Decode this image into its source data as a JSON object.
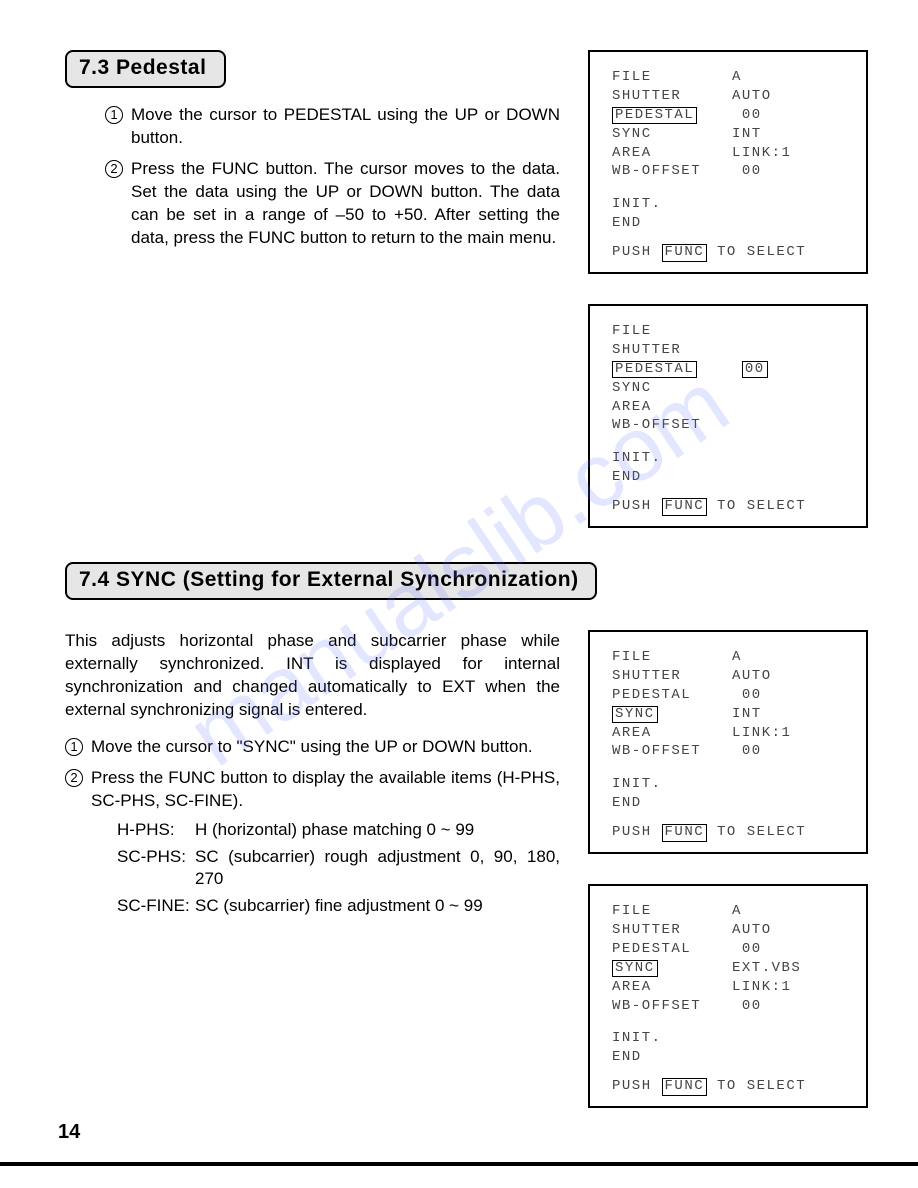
{
  "watermark": "manualslib.com",
  "page_number": "14",
  "section73": {
    "heading": "7.3  Pedestal",
    "steps": [
      "Move the cursor to PEDESTAL using the UP or DOWN button.",
      "Press the FUNC button. The cursor moves to the data. Set the data using the UP or DOWN button. The data can be set in a range of –50 to +50. After setting the data, press the FUNC button to return to the main menu."
    ]
  },
  "section74": {
    "heading": "7.4  SYNC (Setting for External Synchronization)",
    "intro": "This adjusts horizontal phase and subcarrier phase while externally synchronized. INT is displayed for internal synchronization and changed automatically to EXT when the external synchronizing signal is entered.",
    "steps": [
      "Move the cursor to \"SYNC\" using the UP or DOWN button.",
      "Press the FUNC button to display the available items (H-PHS, SC-PHS, SC-FINE)."
    ],
    "defs": [
      {
        "term": "H-PHS:",
        "desc": "H (horizontal) phase matching 0 ~ 99"
      },
      {
        "term": "SC-PHS:",
        "desc": "SC (subcarrier) rough adjustment 0, 90, 180, 270"
      },
      {
        "term": "SC-FINE:",
        "desc": "SC (subcarrier) fine adjustment 0 ~ 99"
      }
    ]
  },
  "screens": {
    "push_line": {
      "push": "PUSH",
      "func": "FUNC",
      "tail": " TO SELECT"
    },
    "labels": {
      "file": "FILE",
      "shutter": "SHUTTER",
      "pedestal": "PEDESTAL",
      "sync": "SYNC",
      "area": "AREA",
      "wboffset": "WB-OFFSET",
      "init": "INIT.",
      "end": "END"
    },
    "s1": {
      "file": "A",
      "shutter": "AUTO",
      "pedestal": "00",
      "sync": "INT",
      "area": "LINK:1",
      "wboffset": "00"
    },
    "s2": {
      "pedestal_val": "00"
    },
    "s3": {
      "file": "A",
      "shutter": "AUTO",
      "pedestal": "00",
      "sync": "INT",
      "area": "LINK:1",
      "wboffset": "00"
    },
    "s4": {
      "file": "A",
      "shutter": "AUTO",
      "pedestal": "00",
      "sync": "EXT.VBS",
      "area": "LINK:1",
      "wboffset": "00"
    }
  }
}
